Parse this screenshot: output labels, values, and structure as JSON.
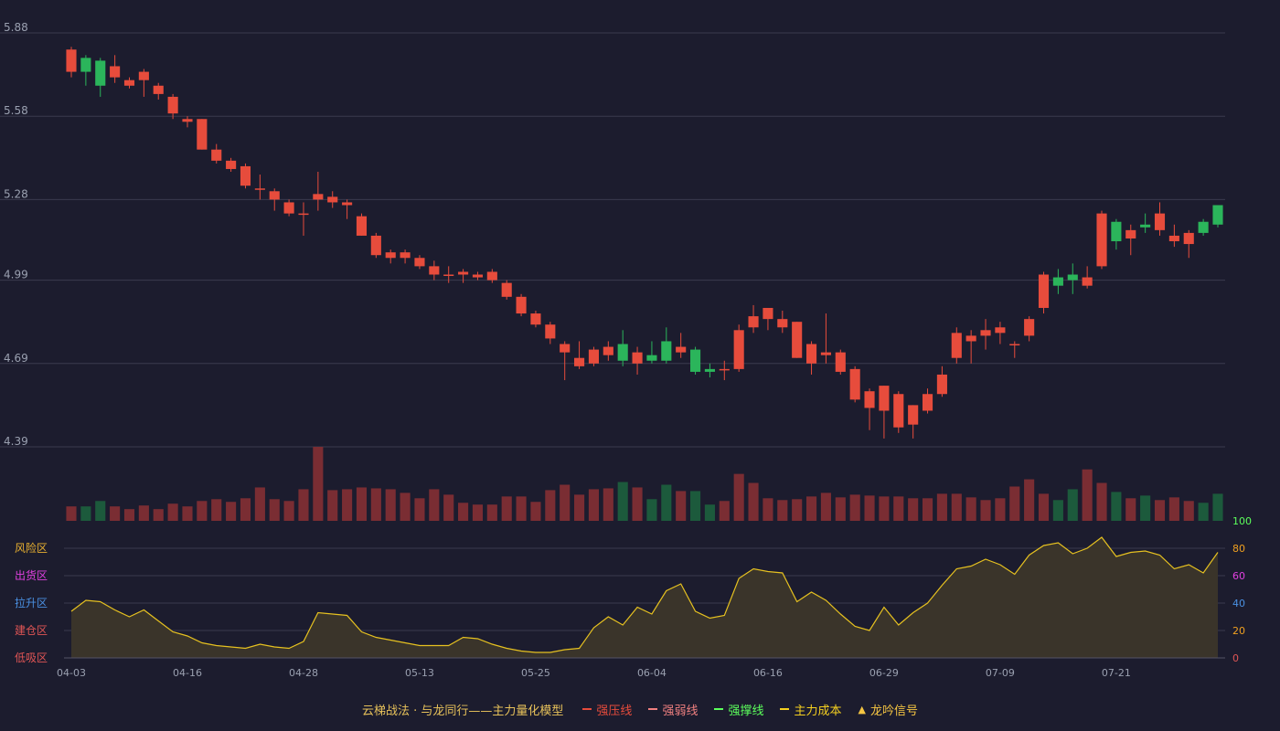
{
  "chart_data": [
    {
      "type": "candlestick",
      "title": "",
      "y_ticks": [
        "5.88",
        "5.58",
        "5.28",
        "4.99",
        "4.69",
        "4.39"
      ],
      "ylim": [
        4.39,
        5.88
      ],
      "x_ticks": [
        {
          "index": 0,
          "label": "04-03"
        },
        {
          "index": 8,
          "label": "04-16"
        },
        {
          "index": 16,
          "label": "04-28"
        },
        {
          "index": 24,
          "label": "05-13"
        },
        {
          "index": 32,
          "label": "05-25"
        },
        {
          "index": 40,
          "label": "06-04"
        },
        {
          "index": 48,
          "label": "06-16"
        },
        {
          "index": 56,
          "label": "06-29"
        },
        {
          "index": 64,
          "label": "07-09"
        },
        {
          "index": 72,
          "label": "07-21"
        }
      ],
      "ohlc": [
        [
          5.74,
          5.82,
          5.72,
          5.83
        ],
        [
          5.79,
          5.74,
          5.69,
          5.8
        ],
        [
          5.78,
          5.69,
          5.65,
          5.79
        ],
        [
          5.72,
          5.76,
          5.7,
          5.8
        ],
        [
          5.69,
          5.71,
          5.68,
          5.72
        ],
        [
          5.71,
          5.74,
          5.65,
          5.75
        ],
        [
          5.66,
          5.69,
          5.64,
          5.7
        ],
        [
          5.59,
          5.65,
          5.57,
          5.66
        ],
        [
          5.56,
          5.57,
          5.54,
          5.58
        ],
        [
          5.46,
          5.57,
          5.46,
          5.57
        ],
        [
          5.42,
          5.46,
          5.41,
          5.48
        ],
        [
          5.39,
          5.42,
          5.38,
          5.43
        ],
        [
          5.33,
          5.4,
          5.32,
          5.41
        ],
        [
          5.32,
          5.32,
          5.28,
          5.37
        ],
        [
          5.28,
          5.31,
          5.24,
          5.32
        ],
        [
          5.23,
          5.27,
          5.22,
          5.28
        ],
        [
          5.23,
          5.23,
          5.15,
          5.27
        ],
        [
          5.28,
          5.3,
          5.24,
          5.38
        ],
        [
          5.27,
          5.29,
          5.25,
          5.31
        ],
        [
          5.26,
          5.27,
          5.21,
          5.28
        ],
        [
          5.15,
          5.22,
          5.15,
          5.23
        ],
        [
          5.08,
          5.15,
          5.07,
          5.16
        ],
        [
          5.07,
          5.09,
          5.05,
          5.1
        ],
        [
          5.07,
          5.09,
          5.05,
          5.1
        ],
        [
          5.04,
          5.07,
          5.03,
          5.08
        ],
        [
          5.01,
          5.04,
          4.99,
          5.06
        ],
        [
          5.01,
          5.01,
          4.98,
          5.04
        ],
        [
          5.01,
          5.02,
          4.98,
          5.03
        ],
        [
          5.0,
          5.01,
          4.99,
          5.02
        ],
        [
          4.99,
          5.02,
          4.98,
          5.03
        ],
        [
          4.93,
          4.98,
          4.92,
          4.99
        ],
        [
          4.87,
          4.93,
          4.86,
          4.94
        ],
        [
          4.83,
          4.87,
          4.82,
          4.88
        ],
        [
          4.78,
          4.83,
          4.76,
          4.84
        ],
        [
          4.73,
          4.76,
          4.63,
          4.77
        ],
        [
          4.68,
          4.71,
          4.67,
          4.77
        ],
        [
          4.69,
          4.74,
          4.68,
          4.75
        ],
        [
          4.72,
          4.75,
          4.7,
          4.77
        ],
        [
          4.76,
          4.7,
          4.68,
          4.81
        ],
        [
          4.69,
          4.73,
          4.65,
          4.75
        ],
        [
          4.72,
          4.7,
          4.69,
          4.77
        ],
        [
          4.77,
          4.7,
          4.69,
          4.82
        ],
        [
          4.73,
          4.75,
          4.71,
          4.8
        ],
        [
          4.74,
          4.66,
          4.65,
          4.75
        ],
        [
          4.67,
          4.66,
          4.64,
          4.69
        ],
        [
          4.67,
          4.67,
          4.63,
          4.7
        ],
        [
          4.67,
          4.81,
          4.66,
          4.83
        ],
        [
          4.82,
          4.86,
          4.8,
          4.9
        ],
        [
          4.85,
          4.89,
          4.81,
          4.89
        ],
        [
          4.82,
          4.85,
          4.8,
          4.88
        ],
        [
          4.71,
          4.84,
          4.71,
          4.84
        ],
        [
          4.69,
          4.76,
          4.65,
          4.77
        ],
        [
          4.72,
          4.73,
          4.69,
          4.87
        ],
        [
          4.66,
          4.73,
          4.65,
          4.74
        ],
        [
          4.56,
          4.67,
          4.55,
          4.68
        ],
        [
          4.53,
          4.59,
          4.45,
          4.6
        ],
        [
          4.52,
          4.61,
          4.42,
          4.61
        ],
        [
          4.46,
          4.58,
          4.44,
          4.59
        ],
        [
          4.47,
          4.54,
          4.42,
          4.54
        ],
        [
          4.52,
          4.58,
          4.51,
          4.6
        ],
        [
          4.58,
          4.65,
          4.57,
          4.68
        ],
        [
          4.71,
          4.8,
          4.69,
          4.82
        ],
        [
          4.77,
          4.79,
          4.69,
          4.81
        ],
        [
          4.79,
          4.81,
          4.74,
          4.85
        ],
        [
          4.8,
          4.82,
          4.76,
          4.84
        ],
        [
          4.76,
          4.76,
          4.71,
          4.77
        ],
        [
          4.79,
          4.85,
          4.77,
          4.86
        ],
        [
          4.89,
          5.01,
          4.87,
          5.02
        ],
        [
          5.0,
          4.97,
          4.94,
          5.03
        ],
        [
          5.01,
          4.99,
          4.94,
          5.05
        ],
        [
          4.97,
          5.0,
          4.96,
          5.04
        ],
        [
          5.04,
          5.23,
          5.03,
          5.24
        ],
        [
          5.2,
          5.13,
          5.1,
          5.21
        ],
        [
          5.14,
          5.17,
          5.08,
          5.19
        ],
        [
          5.19,
          5.18,
          5.16,
          5.23
        ],
        [
          5.17,
          5.23,
          5.15,
          5.27
        ],
        [
          5.13,
          5.15,
          5.11,
          5.19
        ],
        [
          5.12,
          5.16,
          5.07,
          5.17
        ],
        [
          5.2,
          5.16,
          5.15,
          5.21
        ],
        [
          5.26,
          5.19,
          5.18,
          5.26
        ]
      ],
      "volume": [
        16,
        16,
        22,
        16,
        13,
        17,
        13,
        19,
        16,
        22,
        24,
        21,
        25,
        37,
        24,
        22,
        35,
        82,
        34,
        35,
        37,
        36,
        35,
        31,
        25,
        35,
        29,
        20,
        18,
        18,
        27,
        27,
        21,
        34,
        40,
        29,
        35,
        36,
        43,
        37,
        24,
        40,
        33,
        33,
        18,
        22,
        52,
        42,
        25,
        23,
        24,
        27,
        31,
        26,
        29,
        28,
        27,
        27,
        25,
        25,
        30,
        30,
        26,
        23,
        25,
        38,
        46,
        30,
        23,
        35,
        57,
        42,
        32,
        25,
        28,
        23,
        26,
        22,
        20,
        30
      ],
      "volume_ylim": [
        0,
        82
      ]
    },
    {
      "type": "area",
      "y_ticks": [
        "100",
        "80",
        "60",
        "40",
        "20",
        "0"
      ],
      "ylim": [
        0,
        100
      ],
      "zone_labels": [
        "风险区",
        "出货区",
        "拉升区",
        "建仓区",
        "低吸区"
      ],
      "values": [
        34,
        42,
        41,
        35,
        30,
        35,
        27,
        19,
        16,
        11,
        9,
        8,
        7,
        10,
        8,
        7,
        12,
        33,
        32,
        31,
        19,
        15,
        13,
        11,
        9,
        9,
        9,
        15,
        14,
        10,
        7,
        5,
        4,
        4,
        6,
        7,
        22,
        30,
        24,
        37,
        32,
        49,
        54,
        34,
        29,
        31,
        58,
        65,
        63,
        62,
        41,
        48,
        42,
        32,
        23,
        20,
        37,
        24,
        33,
        40,
        53,
        65,
        67,
        72,
        68,
        61,
        75,
        82,
        84,
        76,
        80,
        88,
        74,
        77,
        78,
        75,
        65,
        68,
        62,
        77
      ]
    }
  ],
  "legend": {
    "title": "云梯战法 · 与龙同行——主力量化模型",
    "items": [
      {
        "label": "强压线",
        "color": "#e74c3c",
        "style": "solid"
      },
      {
        "label": "强弱线",
        "color": "#f08080",
        "style": "dashed"
      },
      {
        "label": "强撑线",
        "color": "#5cff5c",
        "style": "solid"
      },
      {
        "label": "主力成本",
        "color": "#f5d020",
        "style": "dashed"
      },
      {
        "label": "龙吟信号",
        "color": "#f5c542",
        "style": "triangle"
      }
    ]
  },
  "colors": {
    "up": "#e74c3c",
    "down": "#2bb55b",
    "vol_up": "#7a2d33",
    "vol_down": "#1c5a3c",
    "grid": "#3a3a4e",
    "axis_text": "#9aa0b0",
    "area_line": "#e6c120",
    "area_fill": "#3a342a",
    "zone_colors": [
      "#e8b030",
      "#e040e0",
      "#4a90e2",
      "#e05555",
      "#e05555"
    ],
    "right_tick_colors": [
      "#5cff5c",
      "#f0a020",
      "#e040e0",
      "#4a90e2",
      "#f0a020",
      "#e05555"
    ]
  }
}
